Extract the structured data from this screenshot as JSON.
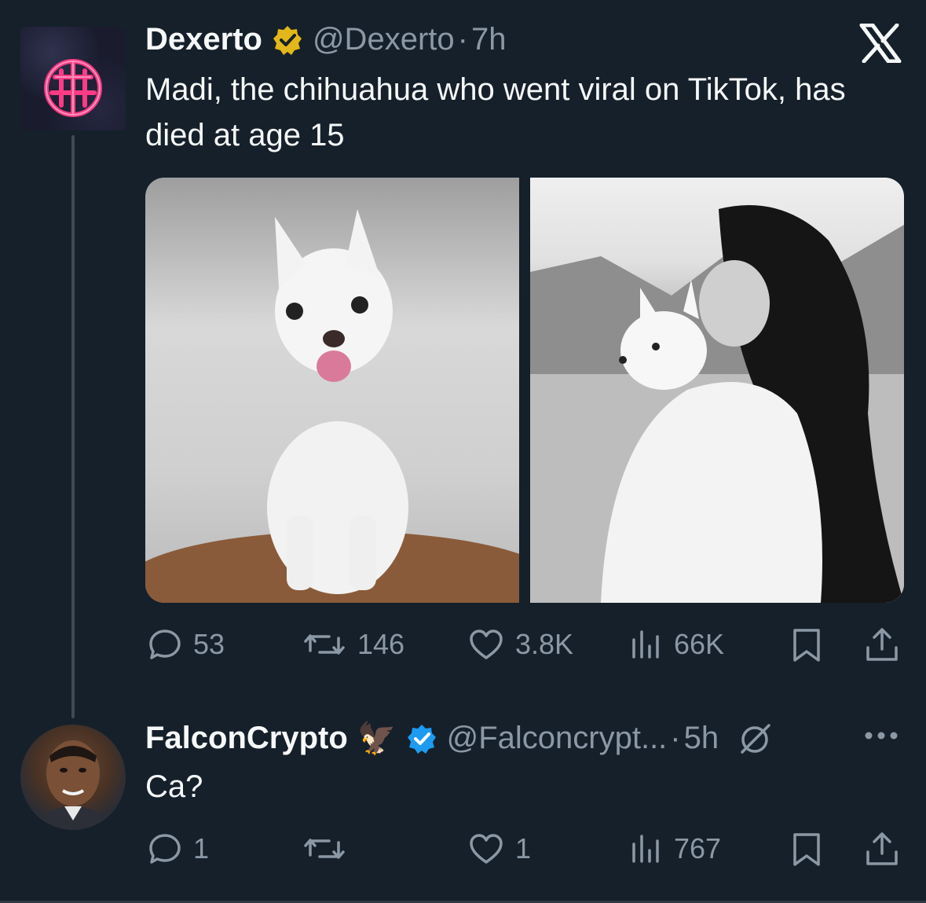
{
  "tweet1": {
    "name": "Dexerto",
    "handle": "@Dexerto",
    "separator": "·",
    "time": "7h",
    "text": "Madi, the chihuahua who went viral on TikTok, has died at age 15",
    "badge": "gold-verified-badge-icon",
    "logo": "x-logo-icon",
    "actions": {
      "replies": "53",
      "reposts": "146",
      "likes": "3.8K",
      "views": "66K"
    }
  },
  "tweet2": {
    "name": "FalconCrypto",
    "name_emoji": "🦅",
    "handle": "@Falconcrypt...",
    "separator": "·",
    "time": "5h",
    "text": "Ca?",
    "badge": "blue-verified-badge-icon",
    "actions": {
      "replies": "1",
      "reposts": "",
      "likes": "1",
      "views": "767"
    }
  },
  "colors": {
    "background": "#15202b",
    "text": "#f7f9f9",
    "muted": "#8b98a5",
    "gold": "#e2b719",
    "blue": "#1d9bf0",
    "neon": "#ff2d78"
  }
}
